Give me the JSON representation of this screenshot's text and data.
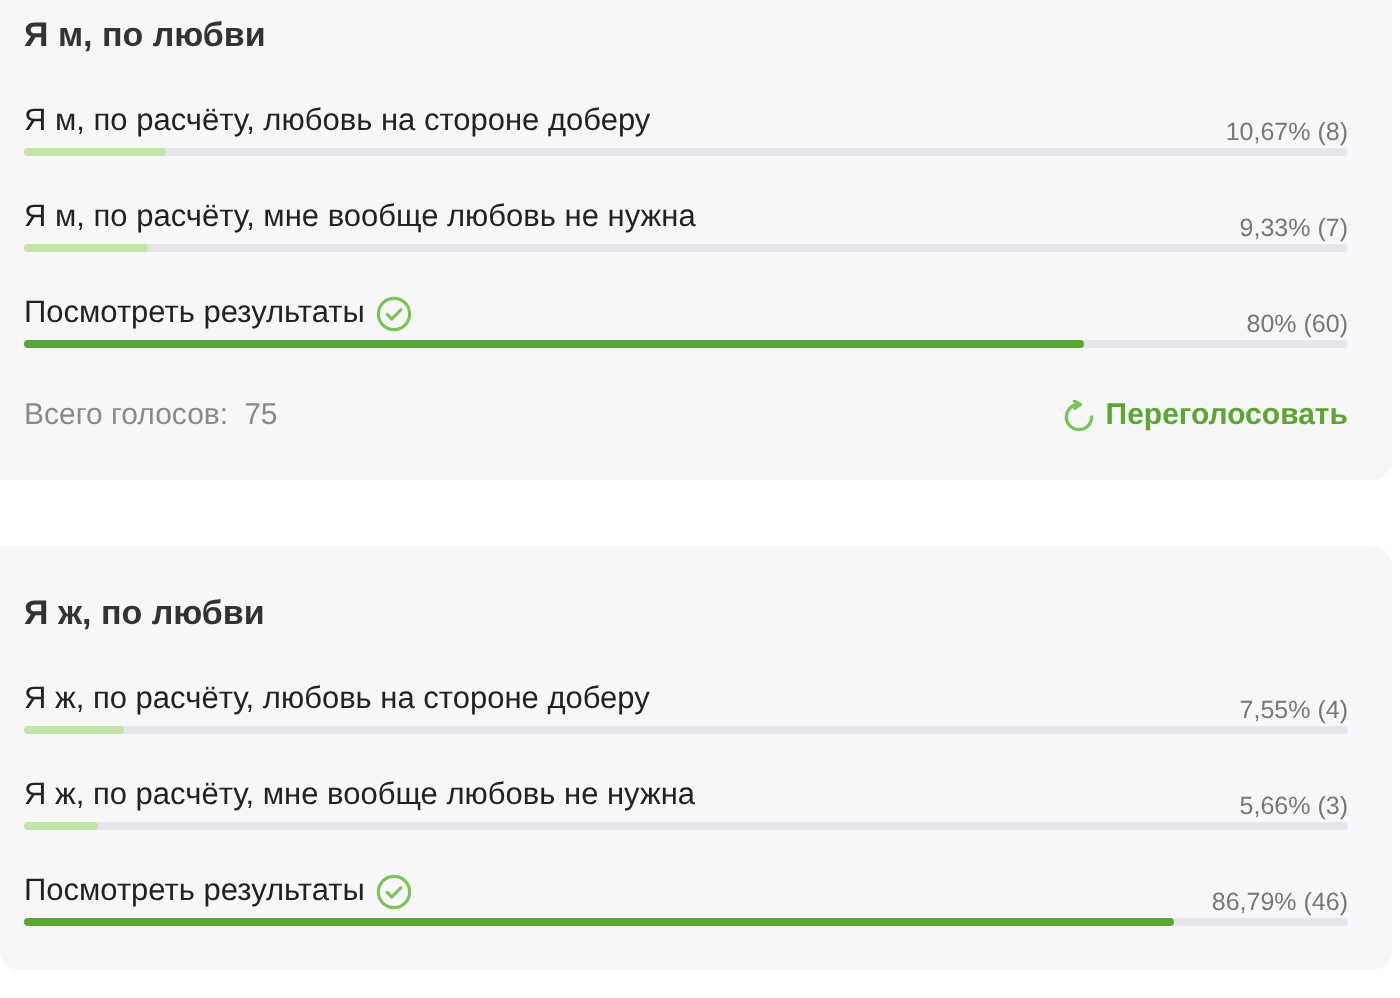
{
  "polls": [
    {
      "title": "Я м, по любви",
      "options": [
        {
          "label": "Я м, по расчёту, любовь на стороне доберу",
          "result": "10,67% (8)",
          "level": 0.1067,
          "selected": false
        },
        {
          "label": "Я м, по расчёту, мне вообще любовь не нужна",
          "result": "9,33% (7)",
          "level": 0.0933,
          "selected": false
        },
        {
          "label": "Посмотреть результаты",
          "result": "80% (60)",
          "level": 0.8,
          "selected": true
        }
      ],
      "footer": {
        "total_label": "Всего голосов:",
        "total": "75",
        "revote": "Переголосовать"
      }
    },
    {
      "title": "Я ж, по любви",
      "options": [
        {
          "label": "Я ж, по расчёту, любовь на стороне доберу",
          "result": "7,55% (4)",
          "level": 0.0755,
          "selected": false
        },
        {
          "label": "Я ж, по расчёту, мне вообще любовь не нужна",
          "result": "5,66% (3)",
          "level": 0.0566,
          "selected": false
        },
        {
          "label": "Посмотреть результаты",
          "result": "86,79% (46)",
          "level": 0.8679,
          "selected": true
        }
      ]
    }
  ]
}
